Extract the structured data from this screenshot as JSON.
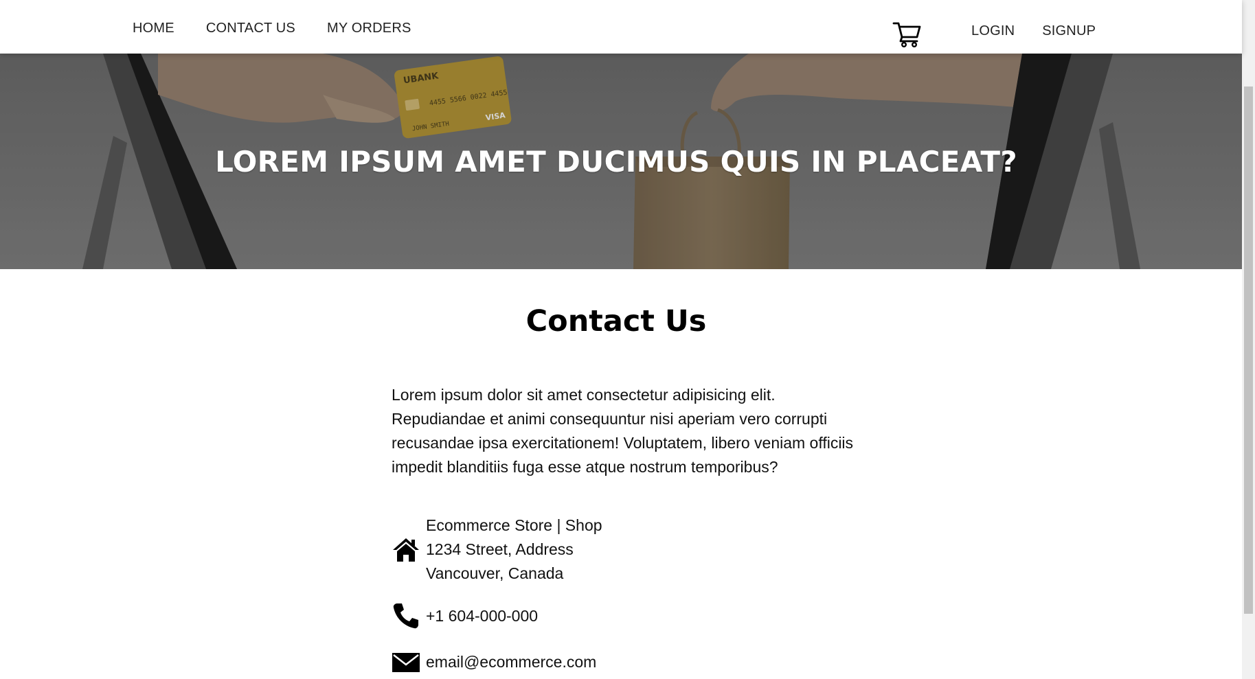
{
  "nav": {
    "links": [
      "HOME",
      "CONTACT US",
      "MY ORDERS"
    ],
    "login": "LOGIN",
    "signup": "SIGNUP",
    "cart_icon": "cart-icon"
  },
  "hero": {
    "title": "LOREM IPSUM AMET DUCIMUS QUIS IN PLACEAT?",
    "card": {
      "bank": "UBANK",
      "number": "4455 5566 0022 4455",
      "holder": "JOHN SMITH",
      "brand": "VISA"
    }
  },
  "contact": {
    "title": "Contact Us",
    "intro": "Lorem ipsum dolor sit amet consectetur adipisicing elit. Repudiandae et animi consequuntur nisi aperiam vero corrupti recusandae ipsa exercitationem! Voluptatem, libero veniam officiis impedit blanditiis fuga esse atque nostrum temporibus?",
    "address": [
      "Ecommerce Store | Shop",
      "1234 Street, Address",
      "Vancouver, Canada"
    ],
    "phone": "+1 604-000-000",
    "email": "email@ecommerce.com"
  },
  "colors": {
    "hero_overlay": "#6d6d6d",
    "text": "#111111",
    "nav_bg": "#ffffff"
  }
}
